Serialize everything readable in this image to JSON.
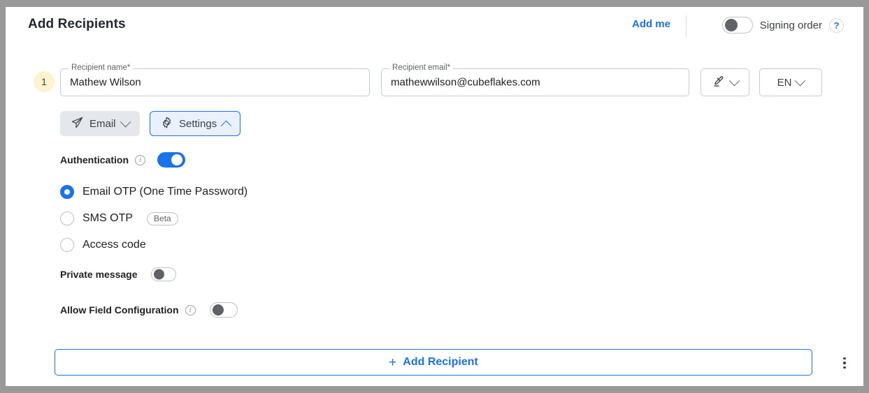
{
  "header": {
    "title": "Add Recipients",
    "add_me_label": "Add me",
    "signing_order_label": "Signing order",
    "signing_order_on": false,
    "help_icon_label": "?"
  },
  "recipient": {
    "number": "1",
    "name_field": {
      "legend": "Recipient name*",
      "value": "Mathew Wilson"
    },
    "email_field": {
      "legend": "Recipient email*",
      "value": "mathewwilson@cubeflakes.com"
    },
    "signature_select": {
      "icon": "signature-pen-icon"
    },
    "language_select": {
      "value": "EN"
    },
    "delivery_button": {
      "label": "Email",
      "icon": "paper-plane-icon"
    },
    "settings_button": {
      "label": "Settings",
      "icon": "gear-icon"
    }
  },
  "settings": {
    "authentication": {
      "label": "Authentication",
      "enabled": true,
      "options": [
        {
          "label": "Email OTP (One Time Password)",
          "selected": true,
          "badge": ""
        },
        {
          "label": "SMS OTP",
          "selected": false,
          "badge": "Beta"
        },
        {
          "label": "Access code",
          "selected": false,
          "badge": ""
        }
      ]
    },
    "private_message": {
      "label": "Private message",
      "enabled": false
    },
    "allow_field_configuration": {
      "label": "Allow Field Configuration",
      "enabled": false
    }
  },
  "footer": {
    "add_recipient_label": "Add Recipient",
    "add_recipient_plus": "+",
    "more_options_icon": "kebab-menu-icon"
  },
  "colors": {
    "accent": "#1a73e8",
    "frame": "#999999",
    "badge_bg": "#fdf3cf",
    "field_border": "#c3cbd4"
  }
}
